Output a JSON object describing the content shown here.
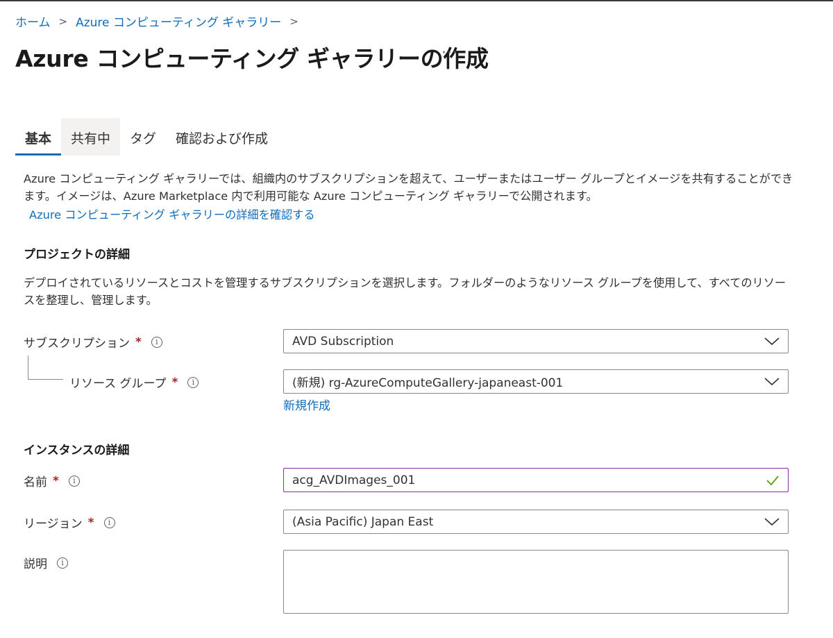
{
  "breadcrumb": {
    "home": "ホーム",
    "parent": "Azure コンピューティング ギャラリー",
    "sep": ">"
  },
  "page": {
    "title": "Azure コンピューティング ギャラリーの作成",
    "more": "···"
  },
  "tabs": [
    {
      "label": "基本",
      "active": true
    },
    {
      "label": "共有中"
    },
    {
      "label": "タグ"
    },
    {
      "label": "確認および作成"
    }
  ],
  "intro": {
    "text": "Azure コンピューティング ギャラリーでは、組織内のサブスクリプションを超えて、ユーザーまたはユーザー グループとイメージを共有することができます。イメージは、Azure Marketplace 内で利用可能な Azure コンピューティング ギャラリーで公開されます。",
    "link": "Azure コンピューティング ギャラリーの詳細を確認する"
  },
  "project": {
    "heading": "プロジェクトの詳細",
    "description": "デプロイされているリソースとコストを管理するサブスクリプションを選択します。フォルダーのようなリソース グループを使用して、すべてのリソースを整理し、管理します。",
    "subscription_label": "サブスクリプション",
    "subscription_value": "AVD Subscription",
    "resource_group_label": "リソース グループ",
    "resource_group_value": "(新規) rg-AzureComputeGallery-japaneast-001",
    "create_new": "新規作成"
  },
  "instance": {
    "heading": "インスタンスの詳細",
    "name_label": "名前",
    "name_value": "acg_AVDImages_001",
    "region_label": "リージョン",
    "region_value": "(Asia Pacific) Japan East",
    "description_label": "説明",
    "description_value": ""
  },
  "symbols": {
    "required": "*",
    "info": "i"
  },
  "colors": {
    "link": "#0f6cbd",
    "required": "#a4262c",
    "valid_check": "#57a300",
    "valid_border": "#8a2da5"
  }
}
